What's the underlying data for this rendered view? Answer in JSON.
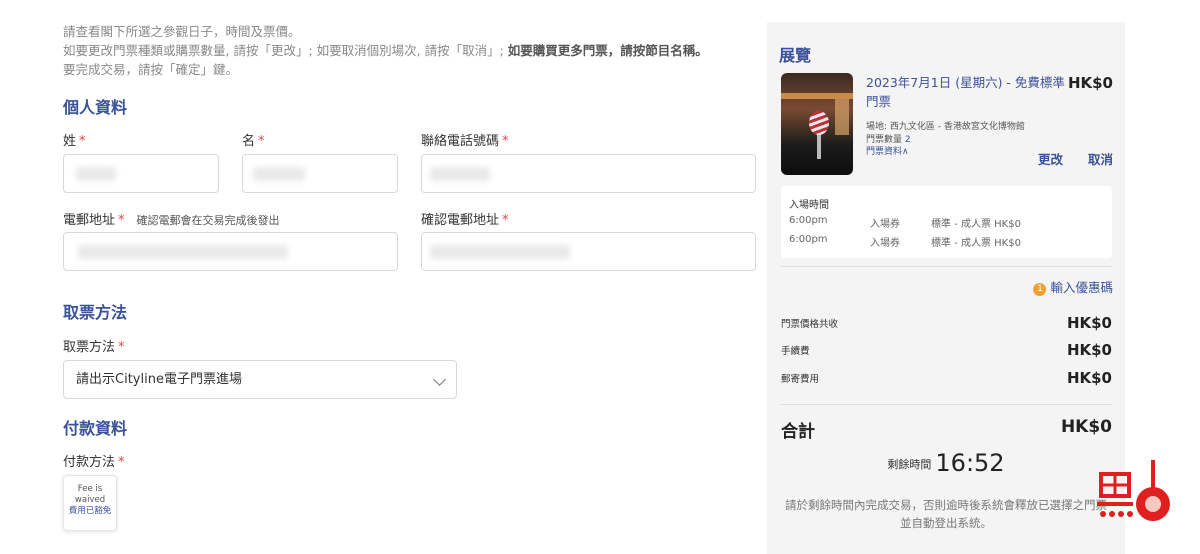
{
  "intro": {
    "line1": "請查看閣下所選之參觀日子，時間及票價。",
    "line2_a": "如要更改門票種類或購票數量, 請按「更改」; 如要取消個別場次, 請按「取消」; ",
    "line2_b": "如要購買更多門票，請按節目名稱。",
    "line3": "要完成交易，請按「確定」鍵。"
  },
  "personal": {
    "title": "個人資料",
    "surname_label": "姓",
    "given_label": "名",
    "phone_label": "聯絡電話號碼",
    "email_label": "電郵地址",
    "email_hint": "確認電郵會在交易完成後發出",
    "confirm_email_label": "確認電郵地址",
    "required_mark": "*"
  },
  "delivery": {
    "title": "取票方法",
    "label": "取票方法",
    "selected": "請出示Cityline電子門票進場"
  },
  "payment": {
    "title": "付款資料",
    "label": "付款方法",
    "card_en_1": "Fee is",
    "card_en_2": "waived",
    "card_zh": "費用已豁免"
  },
  "summary": {
    "title": "展覽",
    "event_title": "2023年7月1日 (星期六) - 免費標準門票",
    "event_price": "HK$0",
    "venue": "場地: 西九文化區 - 香港故宮文化博物館",
    "qty_label": "門票數量",
    "qty_value": "2",
    "ticket_info": "門票資料∧",
    "edit": "更改",
    "cancel": "取消",
    "entry_header": "入場時間",
    "entries": [
      {
        "time": "6:00pm",
        "type": "入場券",
        "desc": "標準 - 成人票 HK$0"
      },
      {
        "time": "6:00pm",
        "type": "入場券",
        "desc": "標準 - 成人票 HK$0"
      }
    ],
    "promo_icon": "1",
    "promo": "輸入優惠碼",
    "fees": [
      {
        "label": "門票價格共收",
        "value": "HK$0"
      },
      {
        "label": "手續費",
        "value": "HK$0"
      },
      {
        "label": "郵寄費用",
        "value": "HK$0"
      }
    ],
    "total_label": "合計",
    "total_value": "HK$0",
    "timer_label": "剩餘時間",
    "timer_value": "16:52",
    "note": "請於剩餘時間內完成交易，否則逾時後系統會釋放已選擇之門票並自動登出系統。"
  },
  "colors": {
    "accent": "#3a5299",
    "required": "#e04848",
    "promo": "#f0a030"
  }
}
